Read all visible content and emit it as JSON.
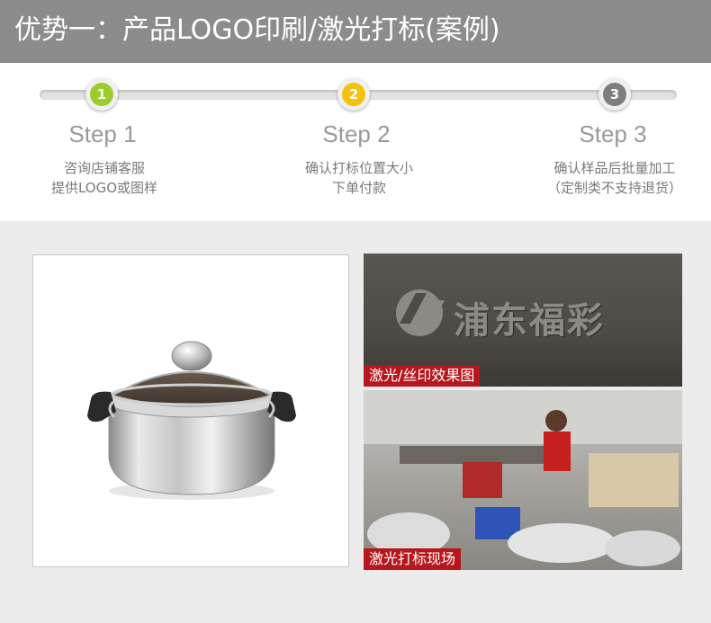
{
  "header": {
    "title": "优势一：产品LOGO印刷/激光打标(案例)"
  },
  "steps": [
    {
      "number": "1",
      "label": "Step 1",
      "desc_line1": "咨询店铺客服",
      "desc_line2": "提供LOGO或图样",
      "color": "#9ccc2c"
    },
    {
      "number": "2",
      "label": "Step 2",
      "desc_line1": "确认打标位置大小",
      "desc_line2": "下单付款",
      "color": "#f3c20f"
    },
    {
      "number": "3",
      "label": "Step 3",
      "desc_line1": "确认样品后批量加工",
      "desc_line2": "（定制类不支持退货）",
      "color": "#7d7d7d"
    }
  ],
  "photos": {
    "top": {
      "sign_text": "浦东福彩",
      "label": "激光/丝印效果图"
    },
    "bottom": {
      "label": "激光打标现场"
    }
  },
  "colors": {
    "header_bg": "#8c8c8c",
    "label_bg": "#b6171c",
    "panel_bg": "#ececec"
  }
}
